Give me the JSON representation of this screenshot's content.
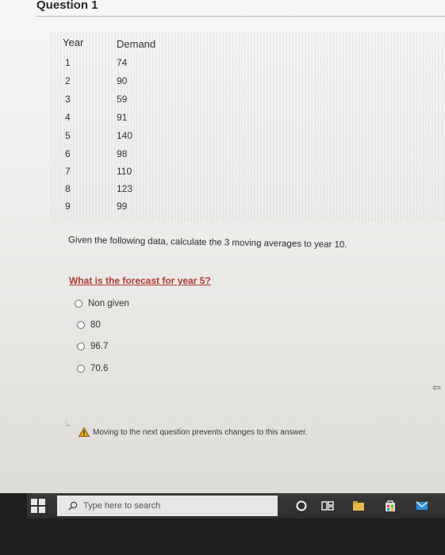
{
  "question": {
    "title": "Question 1"
  },
  "table": {
    "headers": {
      "year": "Year",
      "demand": "Demand"
    },
    "rows": [
      {
        "year": "1",
        "demand": "74"
      },
      {
        "year": "2",
        "demand": "90"
      },
      {
        "year": "3",
        "demand": "59"
      },
      {
        "year": "4",
        "demand": "91"
      },
      {
        "year": "5",
        "demand": "140"
      },
      {
        "year": "6",
        "demand": "98"
      },
      {
        "year": "7",
        "demand": "110"
      },
      {
        "year": "8",
        "demand": "123"
      },
      {
        "year": "9",
        "demand": "99"
      }
    ]
  },
  "instruction": "Given the following data, calculate the 3 moving averages to year 10.",
  "prompt": "What is the forecast for year 5?",
  "options": [
    {
      "label": "Non given"
    },
    {
      "label": "80"
    },
    {
      "label": "96.7"
    },
    {
      "label": "70.6"
    }
  ],
  "warning": {
    "text": "Moving to the next question prevents changes to this answer."
  },
  "taskbar": {
    "search_placeholder": "Type here to search"
  },
  "colors": {
    "prompt": "#b03a2e",
    "warning_icon": "#e8a317"
  }
}
